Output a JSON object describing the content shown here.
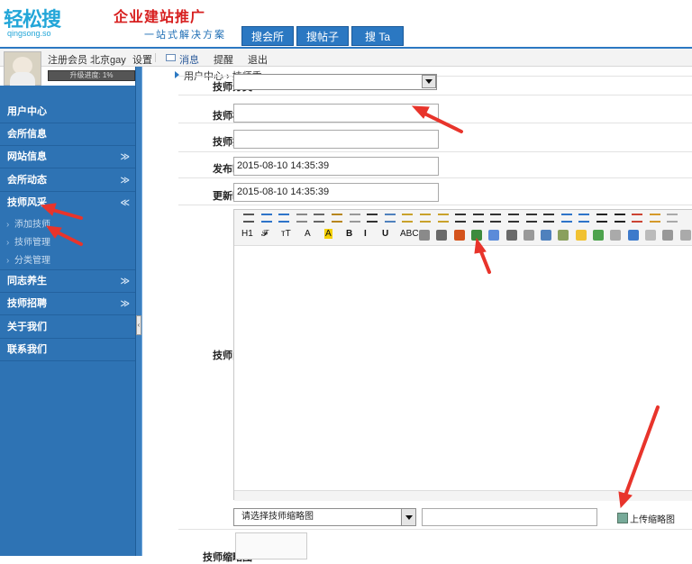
{
  "logo": {
    "text": "轻松搜",
    "sub": "qingsong.so"
  },
  "header": {
    "slogan_main": "企业建站推广",
    "slogan_sub": "一站式解决方案"
  },
  "topnav": [
    {
      "label": "搜会所"
    },
    {
      "label": "搜帖子"
    },
    {
      "label": "搜 Ta"
    }
  ],
  "userbar": {
    "member": "注册会员 北京gay",
    "settings": "设置",
    "messages": "消息",
    "reminders": "提醒",
    "logout": "退出",
    "progress": "升级进度: 1%",
    "progress_value": 1
  },
  "breadcrumb": "用户中心 › 技师秀",
  "sidebar": {
    "items": [
      {
        "label": "用户中心",
        "chevron": ""
      },
      {
        "label": "会所信息",
        "chevron": ""
      },
      {
        "label": "网站信息",
        "chevron": "≫"
      },
      {
        "label": "会所动态",
        "chevron": "≫"
      },
      {
        "label": "技师风采",
        "chevron": "≪"
      }
    ],
    "subitems": [
      {
        "label": "添加技师"
      },
      {
        "label": "技师管理"
      },
      {
        "label": "分类管理"
      }
    ],
    "items2": [
      {
        "label": "同志养生",
        "chevron": "≫"
      },
      {
        "label": "技师招聘",
        "chevron": "≫"
      },
      {
        "label": "关于我们",
        "chevron": ""
      },
      {
        "label": "联系我们",
        "chevron": ""
      }
    ]
  },
  "form": {
    "category_label": "技师分类",
    "title_label": "技师标题",
    "title_value": "",
    "order_label": "技师排序",
    "order_value": "",
    "publish_label": "发布时间",
    "publish_value": "2015-08-10 14:35:39",
    "update_label": "更新时间",
    "update_value": "2015-08-10 14:35:39",
    "content_label": "技师内容",
    "thumb_select": "请选择技师缩略图",
    "thumb_path": "",
    "upload_label": "上传缩略图",
    "thumb_label": "技师缩略图"
  },
  "editor": {
    "toolbar_row2": [
      "H1",
      "𝓕",
      "тT",
      "A",
      "A",
      "B",
      "I",
      "U",
      "ABC"
    ]
  },
  "colors": {
    "sidebar": "#2e73b4",
    "accent": "#2b78c2",
    "arrow": "#e8342b"
  }
}
